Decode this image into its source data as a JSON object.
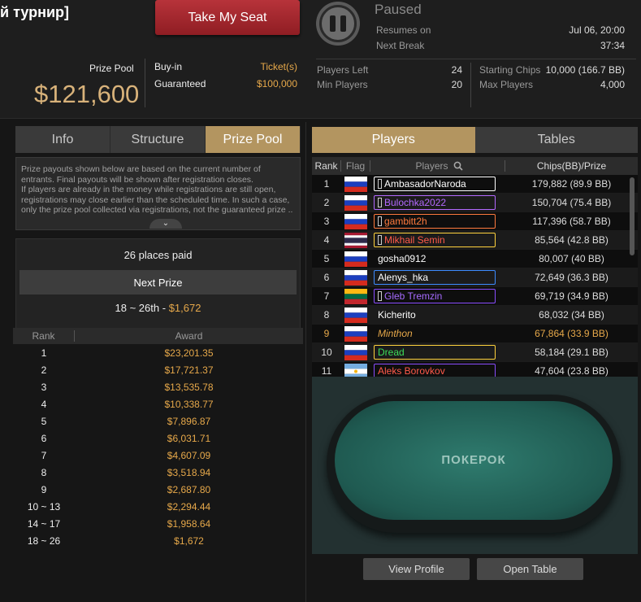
{
  "header": {
    "title": "й турнир]",
    "seat_button": "Take My Seat",
    "prize_pool_label": "Prize Pool",
    "prize_pool_value": "$121,600",
    "buyin_label": "Buy-in",
    "buyin_value": "Ticket(s)",
    "guaranteed_label": "Guaranteed",
    "guaranteed_value": "$100,000",
    "status": "Paused",
    "resumes_label": "Resumes on",
    "resumes_value": "Jul 06, 20:00",
    "next_break_label": "Next Break",
    "next_break_value": "37:34",
    "players_left_label": "Players Left",
    "players_left_value": "24",
    "min_players_label": "Min Players",
    "min_players_value": "20",
    "starting_chips_label": "Starting Chips",
    "starting_chips_value": "10,000 (166.7 BB)",
    "max_players_label": "Max Players",
    "max_players_value": "4,000"
  },
  "left_tabs": [
    "Info",
    "Structure",
    "Prize Pool"
  ],
  "info_text": "Prize payouts shown below are based on the current number of entrants. Final payouts will be shown after registration closes.\nIf players are already in the money while registrations are still open, registrations may close earlier than the scheduled time. In such a case, only the prize pool collected via registrations, not the guaranteed prize ..",
  "places": {
    "paid": "26 places paid",
    "next_prize_label": "Next Prize",
    "range": "18 ~ 26th",
    "dash": "-",
    "amount": "$1,672"
  },
  "payouts": {
    "rank_header": "Rank",
    "award_header": "Award",
    "rows": [
      {
        "rank": "1",
        "award": "$23,201.35"
      },
      {
        "rank": "2",
        "award": "$17,721.37"
      },
      {
        "rank": "3",
        "award": "$13,535.78"
      },
      {
        "rank": "4",
        "award": "$10,338.77"
      },
      {
        "rank": "5",
        "award": "$7,896.87"
      },
      {
        "rank": "6",
        "award": "$6,031.71"
      },
      {
        "rank": "7",
        "award": "$4,607.09"
      },
      {
        "rank": "8",
        "award": "$3,518.94"
      },
      {
        "rank": "9",
        "award": "$2,687.80"
      },
      {
        "rank": "10 ~ 13",
        "award": "$2,294.44"
      },
      {
        "rank": "14 ~ 17",
        "award": "$1,958.64"
      },
      {
        "rank": "18 ~ 26",
        "award": "$1,672"
      }
    ]
  },
  "right_tabs": [
    "Players",
    "Tables"
  ],
  "players": {
    "headers": {
      "rank": "Rank",
      "flag": "Flag",
      "players": "Players",
      "chips": "Chips(BB)/Prize"
    },
    "rows": [
      {
        "rank": "1",
        "flag": "ru",
        "name": "AmbasadorNaroda",
        "chips": "179,882 (89.9 BB)",
        "color": "#ffffff",
        "box": true,
        "icon": true
      },
      {
        "rank": "2",
        "flag": "ru",
        "name": "Bulochka2022",
        "chips": "150,704 (75.4 BB)",
        "color": "#b469ff",
        "box": true,
        "icon": true
      },
      {
        "rank": "3",
        "flag": "ru",
        "name": "gambitt2h",
        "chips": "117,396 (58.7 BB)",
        "color": "#ff7a3d",
        "box": true,
        "icon": true
      },
      {
        "rank": "4",
        "flag": "th",
        "name": "Mikhail Semin",
        "chips": "85,564 (42.8 BB)",
        "color": "#ffd23d",
        "textcolor": "#ff5a4a",
        "box": true,
        "icon": true
      },
      {
        "rank": "5",
        "flag": "ru",
        "name": "gosha0912",
        "chips": "80,007 (40 BB)",
        "color": "",
        "box": false,
        "icon": false
      },
      {
        "rank": "6",
        "flag": "ru",
        "name": "Alenys_hka",
        "chips": "72,649 (36.3 BB)",
        "color": "#3d8bff",
        "textcolor": "#ffffff",
        "box": true,
        "icon": false
      },
      {
        "rank": "7",
        "flag": "lt",
        "name": "Gleb Tremzin",
        "chips": "69,719 (34.9 BB)",
        "color": "#8a4dff",
        "textcolor": "#a66bff",
        "box": true,
        "icon": true
      },
      {
        "rank": "8",
        "flag": "ru",
        "name": "Kicherito",
        "chips": "68,032 (34 BB)",
        "color": "",
        "box": false,
        "icon": false
      },
      {
        "rank": "9",
        "flag": "ru",
        "name": "Minthon",
        "chips": "67,864 (33.9 BB)",
        "color": "",
        "box": false,
        "icon": false,
        "me": true
      },
      {
        "rank": "10",
        "flag": "ru",
        "name": "Dread",
        "chips": "58,184 (29.1 BB)",
        "color": "#ffd23d",
        "textcolor": "#3ddc5a",
        "box": true,
        "icon": false
      },
      {
        "rank": "11",
        "flag": "ar",
        "name": "Aleks Borovkov",
        "chips": "47,604 (23.8 BB)",
        "color": "#8a4dff",
        "textcolor": "#ff5a4a",
        "box": true,
        "icon": false
      }
    ]
  },
  "table_logo": "ПОКЕРОК",
  "buttons": {
    "view_profile": "View Profile",
    "open_table": "Open Table"
  },
  "colors": {
    "gold": "#d8b27a",
    "orange": "#e6a84a",
    "tab_active": "#b39560",
    "seat_red": "#a8272e"
  }
}
